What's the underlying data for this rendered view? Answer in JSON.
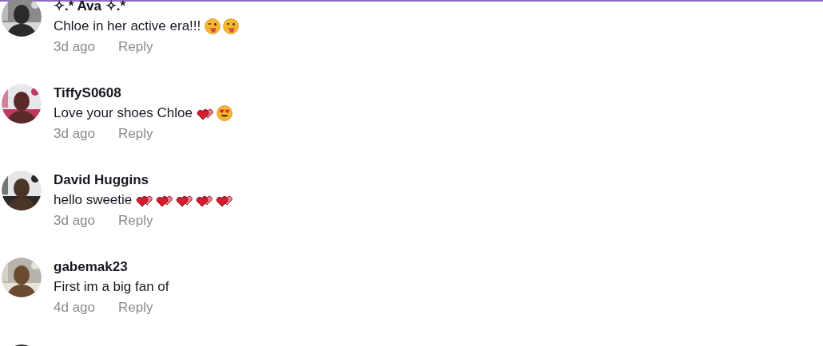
{
  "comments": [
    {
      "author": "✧.* Ava ✧.*",
      "text": "Chloe in her active era!!!",
      "emojis": [
        {
          "kind": "tongue"
        },
        {
          "kind": "tongue"
        }
      ],
      "time": "3d ago",
      "reply": "Reply"
    },
    {
      "author": "TiffyS0608",
      "text": "Love your shoes Chloe",
      "emojis": [
        {
          "kind": "hearts"
        },
        {
          "kind": "heart-eyes"
        }
      ],
      "time": "3d ago",
      "reply": "Reply"
    },
    {
      "author": "David Huggins",
      "text": "hello sweetie",
      "emojis": [
        {
          "kind": "hearts"
        },
        {
          "kind": "hearts"
        },
        {
          "kind": "hearts"
        },
        {
          "kind": "hearts"
        },
        {
          "kind": "hearts"
        }
      ],
      "time": "3d ago",
      "reply": "Reply"
    },
    {
      "author": "gabemak23",
      "text": "First im a big fan of",
      "time": "4d ago",
      "reply": "Reply"
    }
  ]
}
